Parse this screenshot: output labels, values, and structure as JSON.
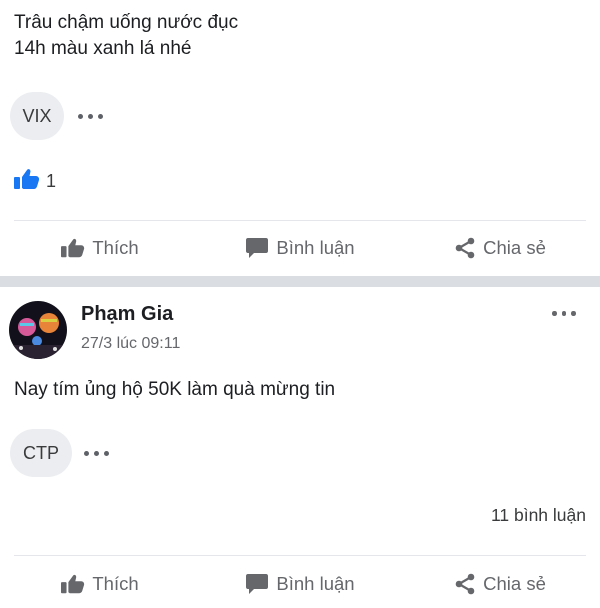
{
  "post1": {
    "text_line1": "Trâu chậm uống nước đục",
    "text_line2": "14h màu xanh lá nhé",
    "tag": "VIX",
    "like_count": "1",
    "actions": {
      "like": "Thích",
      "comment": "Bình luận",
      "share": "Chia sẻ"
    }
  },
  "post2": {
    "author": "Phạm Gia",
    "timestamp": "27/3 lúc 09:11",
    "text": "Nay tím ủng hộ 50K làm quà mừng tin",
    "tag": "CTP",
    "comment_count": "11 bình luận",
    "actions": {
      "like": "Thích",
      "comment": "Bình luận",
      "share": "Chia sẻ"
    }
  },
  "icons": {
    "like": "thumbs-up-icon",
    "reaction": "like-reaction-icon",
    "comment": "comment-icon",
    "share": "share-icon",
    "more": "more-options-icon"
  },
  "colors": {
    "like_blue": "#1877f2",
    "action_gray": "#65676b",
    "separator": "#dadde1",
    "chip_bg": "#ebedf0"
  }
}
